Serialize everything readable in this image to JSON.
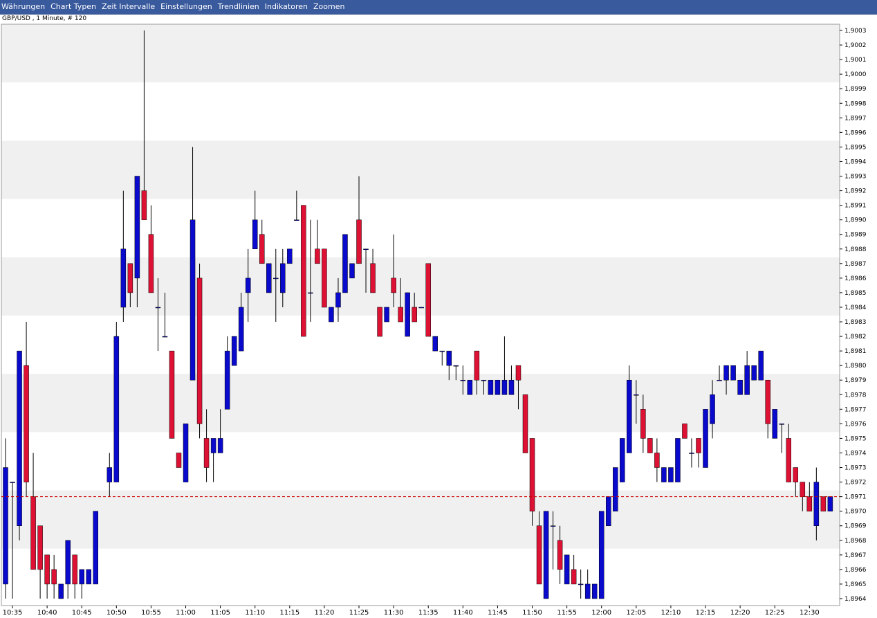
{
  "menu": {
    "items": [
      "Währungen",
      "Chart Typen",
      "Zeit Intervalle",
      "Einstellungen",
      "Trendlinien",
      "Indikatoren",
      "Zoomen"
    ]
  },
  "chart_title": "GBP/USD , 1 Minute, # 120",
  "colors": {
    "up": "#0a0acc",
    "down": "#dd1133",
    "band": "#f0f0f0",
    "current_line": "#cc0000",
    "background": "#ffffff",
    "menubar": "#3a5a9e"
  },
  "chart_data": {
    "type": "candlestick",
    "title": "GBP/USD , 1 Minute, # 120",
    "interval": "1 Minute",
    "current_price": "1,8971",
    "ylim": [
      1.8964,
      1.9003
    ],
    "y_ticks": [
      "1,8964",
      "1,8965",
      "1,8966",
      "1,8967",
      "1,8968",
      "1,8969",
      "1,8970",
      "1,8971",
      "1,8972",
      "1,8973",
      "1,8974",
      "1,8975",
      "1,8976",
      "1,8977",
      "1,8978",
      "1,8979",
      "1,8980",
      "1,8981",
      "1,8982",
      "1,8983",
      "1,8984",
      "1,8985",
      "1,8986",
      "1,8987",
      "1,8988",
      "1,8989",
      "1,8990",
      "1,8991",
      "1,8992",
      "1,8993",
      "1,8994",
      "1,8995",
      "1,8996",
      "1,8997",
      "1,8998",
      "1,8999",
      "1,9000",
      "1,9001",
      "1,9002",
      "1,9003"
    ],
    "x_ticks": [
      "10:35",
      "10:40",
      "10:45",
      "10:50",
      "10:55",
      "11:00",
      "11:05",
      "11:10",
      "11:15",
      "11:20",
      "11:25",
      "11:30",
      "11:35",
      "11:40",
      "11:45",
      "11:50",
      "11:55",
      "12:00",
      "12:05",
      "12:10",
      "12:15",
      "12:20",
      "12:25",
      "12:30"
    ],
    "grid": false,
    "candles": [
      {
        "time": "10:34",
        "open": 1.8965,
        "high": 1.8975,
        "low": 1.8964,
        "close": 1.8973
      },
      {
        "time": "10:35",
        "open": 1.8972,
        "high": 1.8972,
        "low": 1.8964,
        "close": 1.8972
      },
      {
        "time": "10:36",
        "open": 1.8969,
        "high": 1.8981,
        "low": 1.8968,
        "close": 1.8981
      },
      {
        "time": "10:37",
        "open": 1.898,
        "high": 1.8983,
        "low": 1.8971,
        "close": 1.8972
      },
      {
        "time": "10:38",
        "open": 1.8971,
        "high": 1.8974,
        "low": 1.8966,
        "close": 1.8966
      },
      {
        "time": "10:39",
        "open": 1.8969,
        "high": 1.8969,
        "low": 1.8964,
        "close": 1.8966
      },
      {
        "time": "10:40",
        "open": 1.8967,
        "high": 1.8967,
        "low": 1.8964,
        "close": 1.8965
      },
      {
        "time": "10:41",
        "open": 1.8966,
        "high": 1.8967,
        "low": 1.8964,
        "close": 1.8965
      },
      {
        "time": "10:42",
        "open": 1.8964,
        "high": 1.8965,
        "low": 1.8964,
        "close": 1.8965
      },
      {
        "time": "10:43",
        "open": 1.8965,
        "high": 1.8968,
        "low": 1.8964,
        "close": 1.8968
      },
      {
        "time": "10:44",
        "open": 1.8967,
        "high": 1.8967,
        "low": 1.8964,
        "close": 1.8965
      },
      {
        "time": "10:45",
        "open": 1.8965,
        "high": 1.8966,
        "low": 1.8964,
        "close": 1.8966
      },
      {
        "time": "10:46",
        "open": 1.8965,
        "high": 1.8966,
        "low": 1.8965,
        "close": 1.8966
      },
      {
        "time": "10:47",
        "open": 1.8965,
        "high": 1.897,
        "low": 1.8965,
        "close": 1.897
      },
      {
        "time": "10:49",
        "open": 1.8972,
        "high": 1.8974,
        "low": 1.8971,
        "close": 1.8973
      },
      {
        "time": "10:50",
        "open": 1.8972,
        "high": 1.8983,
        "low": 1.8972,
        "close": 1.8982
      },
      {
        "time": "10:51",
        "open": 1.8984,
        "high": 1.8992,
        "low": 1.8983,
        "close": 1.8988
      },
      {
        "time": "10:52",
        "open": 1.8987,
        "high": 1.8987,
        "low": 1.8984,
        "close": 1.8985
      },
      {
        "time": "10:53",
        "open": 1.8986,
        "high": 1.8993,
        "low": 1.8984,
        "close": 1.8993
      },
      {
        "time": "10:54",
        "open": 1.8992,
        "high": 1.9003,
        "low": 1.899,
        "close": 1.899
      },
      {
        "time": "10:55",
        "open": 1.8989,
        "high": 1.8991,
        "low": 1.8985,
        "close": 1.8985
      },
      {
        "time": "10:56",
        "open": 1.8984,
        "high": 1.8986,
        "low": 1.8981,
        "close": 1.8984
      },
      {
        "time": "10:57",
        "open": 1.8982,
        "high": 1.8985,
        "low": 1.8982,
        "close": 1.8982
      },
      {
        "time": "10:58",
        "open": 1.8981,
        "high": 1.8981,
        "low": 1.8975,
        "close": 1.8975
      },
      {
        "time": "10:59",
        "open": 1.8974,
        "high": 1.8974,
        "low": 1.8973,
        "close": 1.8973
      },
      {
        "time": "11:00",
        "open": 1.8972,
        "high": 1.8976,
        "low": 1.8972,
        "close": 1.8976
      },
      {
        "time": "11:01",
        "open": 1.8979,
        "high": 1.8995,
        "low": 1.8979,
        "close": 1.899
      },
      {
        "time": "11:02",
        "open": 1.8986,
        "high": 1.8987,
        "low": 1.8975,
        "close": 1.8976
      },
      {
        "time": "11:03",
        "open": 1.8975,
        "high": 1.8977,
        "low": 1.8972,
        "close": 1.8973
      },
      {
        "time": "11:04",
        "open": 1.8974,
        "high": 1.8975,
        "low": 1.8972,
        "close": 1.8975
      },
      {
        "time": "11:05",
        "open": 1.8974,
        "high": 1.8977,
        "low": 1.8974,
        "close": 1.8975
      },
      {
        "time": "11:06",
        "open": 1.8977,
        "high": 1.8982,
        "low": 1.8977,
        "close": 1.8981
      },
      {
        "time": "11:07",
        "open": 1.898,
        "high": 1.8982,
        "low": 1.898,
        "close": 1.8982
      },
      {
        "time": "11:08",
        "open": 1.8981,
        "high": 1.8985,
        "low": 1.8981,
        "close": 1.8984
      },
      {
        "time": "11:09",
        "open": 1.8985,
        "high": 1.8988,
        "low": 1.8983,
        "close": 1.8986
      },
      {
        "time": "11:10",
        "open": 1.8988,
        "high": 1.8992,
        "low": 1.8988,
        "close": 1.899
      },
      {
        "time": "11:11",
        "open": 1.8989,
        "high": 1.899,
        "low": 1.8987,
        "close": 1.8987
      },
      {
        "time": "11:12",
        "open": 1.8985,
        "high": 1.8987,
        "low": 1.8985,
        "close": 1.8987
      },
      {
        "time": "11:13",
        "open": 1.8986,
        "high": 1.8988,
        "low": 1.8983,
        "close": 1.8986
      },
      {
        "time": "11:14",
        "open": 1.8985,
        "high": 1.8988,
        "low": 1.8984,
        "close": 1.8987
      },
      {
        "time": "11:15",
        "open": 1.8987,
        "high": 1.8988,
        "low": 1.8987,
        "close": 1.8988
      },
      {
        "time": "11:16",
        "open": 1.899,
        "high": 1.8992,
        "low": 1.899,
        "close": 1.899
      },
      {
        "time": "11:17",
        "open": 1.8991,
        "high": 1.8991,
        "low": 1.8982,
        "close": 1.8982
      },
      {
        "time": "11:18",
        "open": 1.8985,
        "high": 1.899,
        "low": 1.8983,
        "close": 1.8985
      },
      {
        "time": "11:19",
        "open": 1.8988,
        "high": 1.899,
        "low": 1.8987,
        "close": 1.8987
      },
      {
        "time": "11:20",
        "open": 1.8988,
        "high": 1.8988,
        "low": 1.8984,
        "close": 1.8984
      },
      {
        "time": "11:21",
        "open": 1.8983,
        "high": 1.8984,
        "low": 1.8983,
        "close": 1.8984
      },
      {
        "time": "11:22",
        "open": 1.8984,
        "high": 1.8986,
        "low": 1.8983,
        "close": 1.8985
      },
      {
        "time": "11:23",
        "open": 1.8985,
        "high": 1.8989,
        "low": 1.8985,
        "close": 1.8989
      },
      {
        "time": "11:24",
        "open": 1.8986,
        "high": 1.8987,
        "low": 1.8986,
        "close": 1.8987
      },
      {
        "time": "11:25",
        "open": 1.899,
        "high": 1.8993,
        "low": 1.8987,
        "close": 1.8987
      },
      {
        "time": "11:26",
        "open": 1.8988,
        "high": 1.8988,
        "low": 1.8985,
        "close": 1.8988
      },
      {
        "time": "11:27",
        "open": 1.8987,
        "high": 1.8988,
        "low": 1.8985,
        "close": 1.8985
      },
      {
        "time": "11:28",
        "open": 1.8984,
        "high": 1.8984,
        "low": 1.8982,
        "close": 1.8982
      },
      {
        "time": "11:29",
        "open": 1.8983,
        "high": 1.8984,
        "low": 1.8983,
        "close": 1.8984
      },
      {
        "time": "11:30",
        "open": 1.8986,
        "high": 1.8989,
        "low": 1.8984,
        "close": 1.8985
      },
      {
        "time": "11:31",
        "open": 1.8984,
        "high": 1.8986,
        "low": 1.8983,
        "close": 1.8983
      },
      {
        "time": "11:32",
        "open": 1.8982,
        "high": 1.8985,
        "low": 1.8982,
        "close": 1.8985
      },
      {
        "time": "11:33",
        "open": 1.8984,
        "high": 1.8985,
        "low": 1.8983,
        "close": 1.8983
      },
      {
        "time": "11:34",
        "open": 1.8984,
        "high": 1.8984,
        "low": 1.8984,
        "close": 1.8984
      },
      {
        "time": "11:35",
        "open": 1.8987,
        "high": 1.8987,
        "low": 1.8982,
        "close": 1.8982
      },
      {
        "time": "11:36",
        "open": 1.8981,
        "high": 1.8982,
        "low": 1.8981,
        "close": 1.8982
      },
      {
        "time": "11:37",
        "open": 1.8981,
        "high": 1.8981,
        "low": 1.898,
        "close": 1.8981
      },
      {
        "time": "11:38",
        "open": 1.898,
        "high": 1.8981,
        "low": 1.8979,
        "close": 1.8981
      },
      {
        "time": "11:39",
        "open": 1.898,
        "high": 1.898,
        "low": 1.8979,
        "close": 1.898
      },
      {
        "time": "11:40",
        "open": 1.8979,
        "high": 1.898,
        "low": 1.8978,
        "close": 1.8979
      },
      {
        "time": "11:41",
        "open": 1.8978,
        "high": 1.8979,
        "low": 1.8978,
        "close": 1.8979
      },
      {
        "time": "11:42",
        "open": 1.8981,
        "high": 1.8981,
        "low": 1.8978,
        "close": 1.8979
      },
      {
        "time": "11:43",
        "open": 1.8979,
        "high": 1.8979,
        "low": 1.8978,
        "close": 1.8979
      },
      {
        "time": "11:44",
        "open": 1.8978,
        "high": 1.8979,
        "low": 1.8978,
        "close": 1.8979
      },
      {
        "time": "11:45",
        "open": 1.8978,
        "high": 1.8979,
        "low": 1.8978,
        "close": 1.8979
      },
      {
        "time": "11:46",
        "open": 1.8978,
        "high": 1.8982,
        "low": 1.8978,
        "close": 1.8979
      },
      {
        "time": "11:47",
        "open": 1.8978,
        "high": 1.898,
        "low": 1.8978,
        "close": 1.8979
      },
      {
        "time": "11:48",
        "open": 1.898,
        "high": 1.898,
        "low": 1.8977,
        "close": 1.8979
      },
      {
        "time": "11:49",
        "open": 1.8978,
        "high": 1.8978,
        "low": 1.8974,
        "close": 1.8974
      },
      {
        "time": "11:50",
        "open": 1.8975,
        "high": 1.8975,
        "low": 1.8969,
        "close": 1.897
      },
      {
        "time": "11:51",
        "open": 1.8969,
        "high": 1.897,
        "low": 1.8965,
        "close": 1.8965
      },
      {
        "time": "11:52",
        "open": 1.8964,
        "high": 1.897,
        "low": 1.8964,
        "close": 1.897
      },
      {
        "time": "11:53",
        "open": 1.8969,
        "high": 1.897,
        "low": 1.8966,
        "close": 1.8969
      },
      {
        "time": "11:54",
        "open": 1.8968,
        "high": 1.8969,
        "low": 1.8965,
        "close": 1.8966
      },
      {
        "time": "11:55",
        "open": 1.8965,
        "high": 1.8967,
        "low": 1.8965,
        "close": 1.8967
      },
      {
        "time": "11:56",
        "open": 1.8966,
        "high": 1.8967,
        "low": 1.8965,
        "close": 1.8965
      },
      {
        "time": "11:57",
        "open": 1.8965,
        "high": 1.8966,
        "low": 1.8964,
        "close": 1.8965
      },
      {
        "time": "11:58",
        "open": 1.8964,
        "high": 1.8966,
        "low": 1.8964,
        "close": 1.8965
      },
      {
        "time": "11:59",
        "open": 1.8964,
        "high": 1.8965,
        "low": 1.8964,
        "close": 1.8965
      },
      {
        "time": "12:00",
        "open": 1.8964,
        "high": 1.897,
        "low": 1.8964,
        "close": 1.897
      },
      {
        "time": "12:01",
        "open": 1.8969,
        "high": 1.8971,
        "low": 1.8969,
        "close": 1.8971
      },
      {
        "time": "12:02",
        "open": 1.897,
        "high": 1.8973,
        "low": 1.897,
        "close": 1.8973
      },
      {
        "time": "12:03",
        "open": 1.8972,
        "high": 1.8975,
        "low": 1.8972,
        "close": 1.8975
      },
      {
        "time": "12:04",
        "open": 1.8974,
        "high": 1.898,
        "low": 1.8974,
        "close": 1.8979
      },
      {
        "time": "12:05",
        "open": 1.8978,
        "high": 1.8979,
        "low": 1.8976,
        "close": 1.8978
      },
      {
        "time": "12:06",
        "open": 1.8977,
        "high": 1.8978,
        "low": 1.8974,
        "close": 1.8975
      },
      {
        "time": "12:07",
        "open": 1.8975,
        "high": 1.8975,
        "low": 1.8974,
        "close": 1.8974
      },
      {
        "time": "12:08",
        "open": 1.8974,
        "high": 1.8975,
        "low": 1.8972,
        "close": 1.8973
      },
      {
        "time": "12:09",
        "open": 1.8972,
        "high": 1.8973,
        "low": 1.8972,
        "close": 1.8973
      },
      {
        "time": "12:10",
        "open": 1.8972,
        "high": 1.8973,
        "low": 1.8972,
        "close": 1.8973
      },
      {
        "time": "12:11",
        "open": 1.8972,
        "high": 1.8975,
        "low": 1.8972,
        "close": 1.8975
      },
      {
        "time": "12:12",
        "open": 1.8976,
        "high": 1.8976,
        "low": 1.8975,
        "close": 1.8975
      },
      {
        "time": "12:13",
        "open": 1.8974,
        "high": 1.8975,
        "low": 1.8973,
        "close": 1.8974
      },
      {
        "time": "12:14",
        "open": 1.8975,
        "high": 1.8975,
        "low": 1.8973,
        "close": 1.8974
      },
      {
        "time": "12:15",
        "open": 1.8973,
        "high": 1.8977,
        "low": 1.8973,
        "close": 1.8977
      },
      {
        "time": "12:16",
        "open": 1.8976,
        "high": 1.8979,
        "low": 1.8975,
        "close": 1.8978
      },
      {
        "time": "12:17",
        "open": 1.8979,
        "high": 1.898,
        "low": 1.8979,
        "close": 1.8979
      },
      {
        "time": "12:18",
        "open": 1.8979,
        "high": 1.898,
        "low": 1.8978,
        "close": 1.898
      },
      {
        "time": "12:19",
        "open": 1.8979,
        "high": 1.898,
        "low": 1.8979,
        "close": 1.898
      },
      {
        "time": "12:20",
        "open": 1.8978,
        "high": 1.8979,
        "low": 1.8978,
        "close": 1.8979
      },
      {
        "time": "12:21",
        "open": 1.8978,
        "high": 1.8981,
        "low": 1.8978,
        "close": 1.898
      },
      {
        "time": "12:22",
        "open": 1.8979,
        "high": 1.898,
        "low": 1.8979,
        "close": 1.898
      },
      {
        "time": "12:23",
        "open": 1.8979,
        "high": 1.8981,
        "low": 1.8979,
        "close": 1.8981
      },
      {
        "time": "12:24",
        "open": 1.8979,
        "high": 1.8979,
        "low": 1.8975,
        "close": 1.8976
      },
      {
        "time": "12:25",
        "open": 1.8975,
        "high": 1.8977,
        "low": 1.8975,
        "close": 1.8977
      },
      {
        "time": "12:26",
        "open": 1.8976,
        "high": 1.8976,
        "low": 1.8974,
        "close": 1.8976
      },
      {
        "time": "12:27",
        "open": 1.8975,
        "high": 1.8976,
        "low": 1.8972,
        "close": 1.8972
      },
      {
        "time": "12:28",
        "open": 1.8973,
        "high": 1.8973,
        "low": 1.8971,
        "close": 1.8972
      },
      {
        "time": "12:29",
        "open": 1.8972,
        "high": 1.8972,
        "low": 1.897,
        "close": 1.8971
      },
      {
        "time": "12:30",
        "open": 1.8971,
        "high": 1.8972,
        "low": 1.897,
        "close": 1.897
      },
      {
        "time": "12:31",
        "open": 1.8969,
        "high": 1.8973,
        "low": 1.8968,
        "close": 1.8972
      },
      {
        "time": "12:32",
        "open": 1.8971,
        "high": 1.8971,
        "low": 1.897,
        "close": 1.897
      },
      {
        "time": "12:33",
        "open": 1.897,
        "high": 1.8971,
        "low": 1.897,
        "close": 1.8971
      }
    ]
  }
}
